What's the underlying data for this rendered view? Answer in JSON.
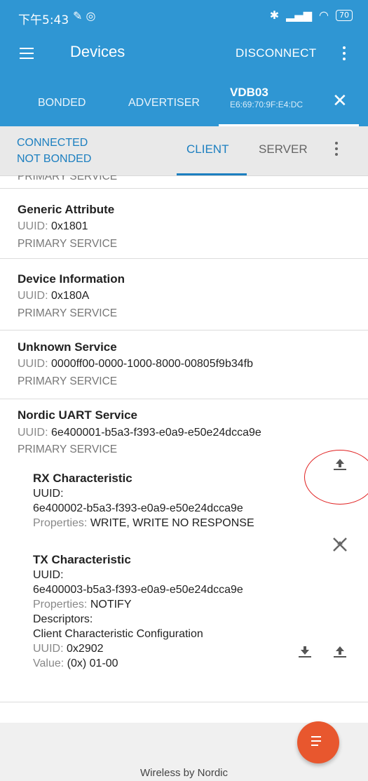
{
  "statusbar": {
    "time": "下午5:43",
    "battery": "70"
  },
  "appbar": {
    "title": "Devices",
    "disconnect": "DISCONNECT"
  },
  "device_tabs": {
    "bonded": "BONDED",
    "advertiser": "ADVERTISER",
    "device_name": "VDB03",
    "device_address": "E6:69:70:9F:E4:DC"
  },
  "subbar": {
    "connected": "CONNECTED",
    "bonded_state": "NOT BONDED",
    "client": "CLIENT",
    "server": "SERVER"
  },
  "labels": {
    "uuid": "UUID:",
    "properties": "Properties:",
    "descriptors": "Descriptors:",
    "value": "Value:"
  },
  "services": [
    {
      "name": "",
      "uuid": "",
      "type": "PRIMARY SERVICE"
    },
    {
      "name": "Generic Attribute",
      "uuid": "0x1801",
      "type": "PRIMARY SERVICE"
    },
    {
      "name": "Device Information",
      "uuid": "0x180A",
      "type": "PRIMARY SERVICE"
    },
    {
      "name": "Unknown Service",
      "uuid": "0000ff00-0000-1000-8000-00805f9b34fb",
      "type": "PRIMARY SERVICE"
    },
    {
      "name": "Nordic UART Service",
      "uuid": "6e400001-b5a3-f393-e0a9-e50e24dcca9e",
      "type": "PRIMARY SERVICE"
    }
  ],
  "characteristics": [
    {
      "name": "RX Characteristic",
      "uuid": "6e400002-b5a3-f393-e0a9-e50e24dcca9e",
      "properties": "WRITE, WRITE NO RESPONSE"
    },
    {
      "name": "TX Characteristic",
      "uuid": "6e400003-b5a3-f393-e0a9-e50e24dcca9e",
      "properties": "NOTIFY",
      "descriptor": {
        "name": "Client Characteristic Configuration",
        "uuid": "0x2902",
        "value": "(0x) 01-00"
      }
    }
  ],
  "footer": {
    "brand": "Wireless by Nordic"
  },
  "colors": {
    "primary": "#2f96d3",
    "accent": "#e8572e",
    "link": "#1c7fc0"
  }
}
